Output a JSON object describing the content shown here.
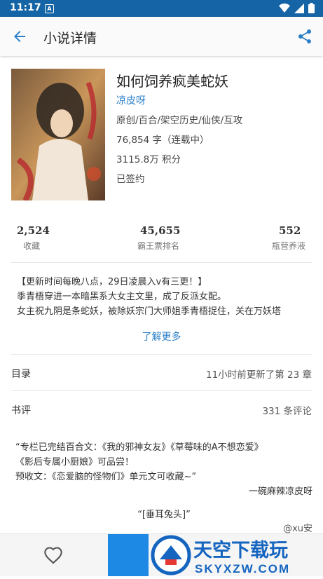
{
  "status_bar": {
    "time": "11:17",
    "notif_letter": "A"
  },
  "app_bar": {
    "title": "小说详情",
    "back_icon": "arrow-back-icon",
    "share_icon": "share-icon"
  },
  "book": {
    "title": "如何饲养疯美蛇妖",
    "author": "凉皮呀",
    "tags": "原创/百合/架空历史/仙侠/互攻",
    "words": "76,854 字（连载中）",
    "points": "3115.8万 积分",
    "signed": "已签约"
  },
  "stats": [
    {
      "value": "2,524",
      "label": "收藏"
    },
    {
      "value": "45,655",
      "label": "霸王票排名"
    },
    {
      "value": "552",
      "label": "瓶营养液"
    }
  ],
  "synopsis": [
    "【更新时间每晚八点，29日凌晨入v有三更！】",
    "季青梧穿进一本暗黑系大女主文里，成了反派女配。",
    "女主祝九阴是条蛇妖，被除妖宗门大师姐季青梧捉住，关在万妖塔"
  ],
  "more_label": "了解更多",
  "catalog": {
    "label": "目录",
    "value": "11小时前更新了第 23 章"
  },
  "reviews": {
    "label": "书评",
    "value": "331 条评论"
  },
  "review_text": {
    "lines": [
      "“专栏已完结百合文：《我的邪神女友》《草莓味的A不想恋爱》",
      "《影后专属小厨娘》可品尝！",
      "预收文：《恋爱脑的怪物们》单元文可收藏~”"
    ],
    "signature": "一碗麻辣凉皮呀",
    "quote": "“[垂耳兔头]”",
    "reviewer": "@xu安"
  },
  "bottom": {
    "fav_icon": "heart-outline-icon"
  },
  "watermark": {
    "cn": "天空下载玩",
    "en": "SKYXZW.COM"
  },
  "colors": {
    "accent": "#2a7fc9",
    "status_bar": "#1565a6",
    "button": "#1e88e5",
    "watermark_red": "#e53935"
  }
}
